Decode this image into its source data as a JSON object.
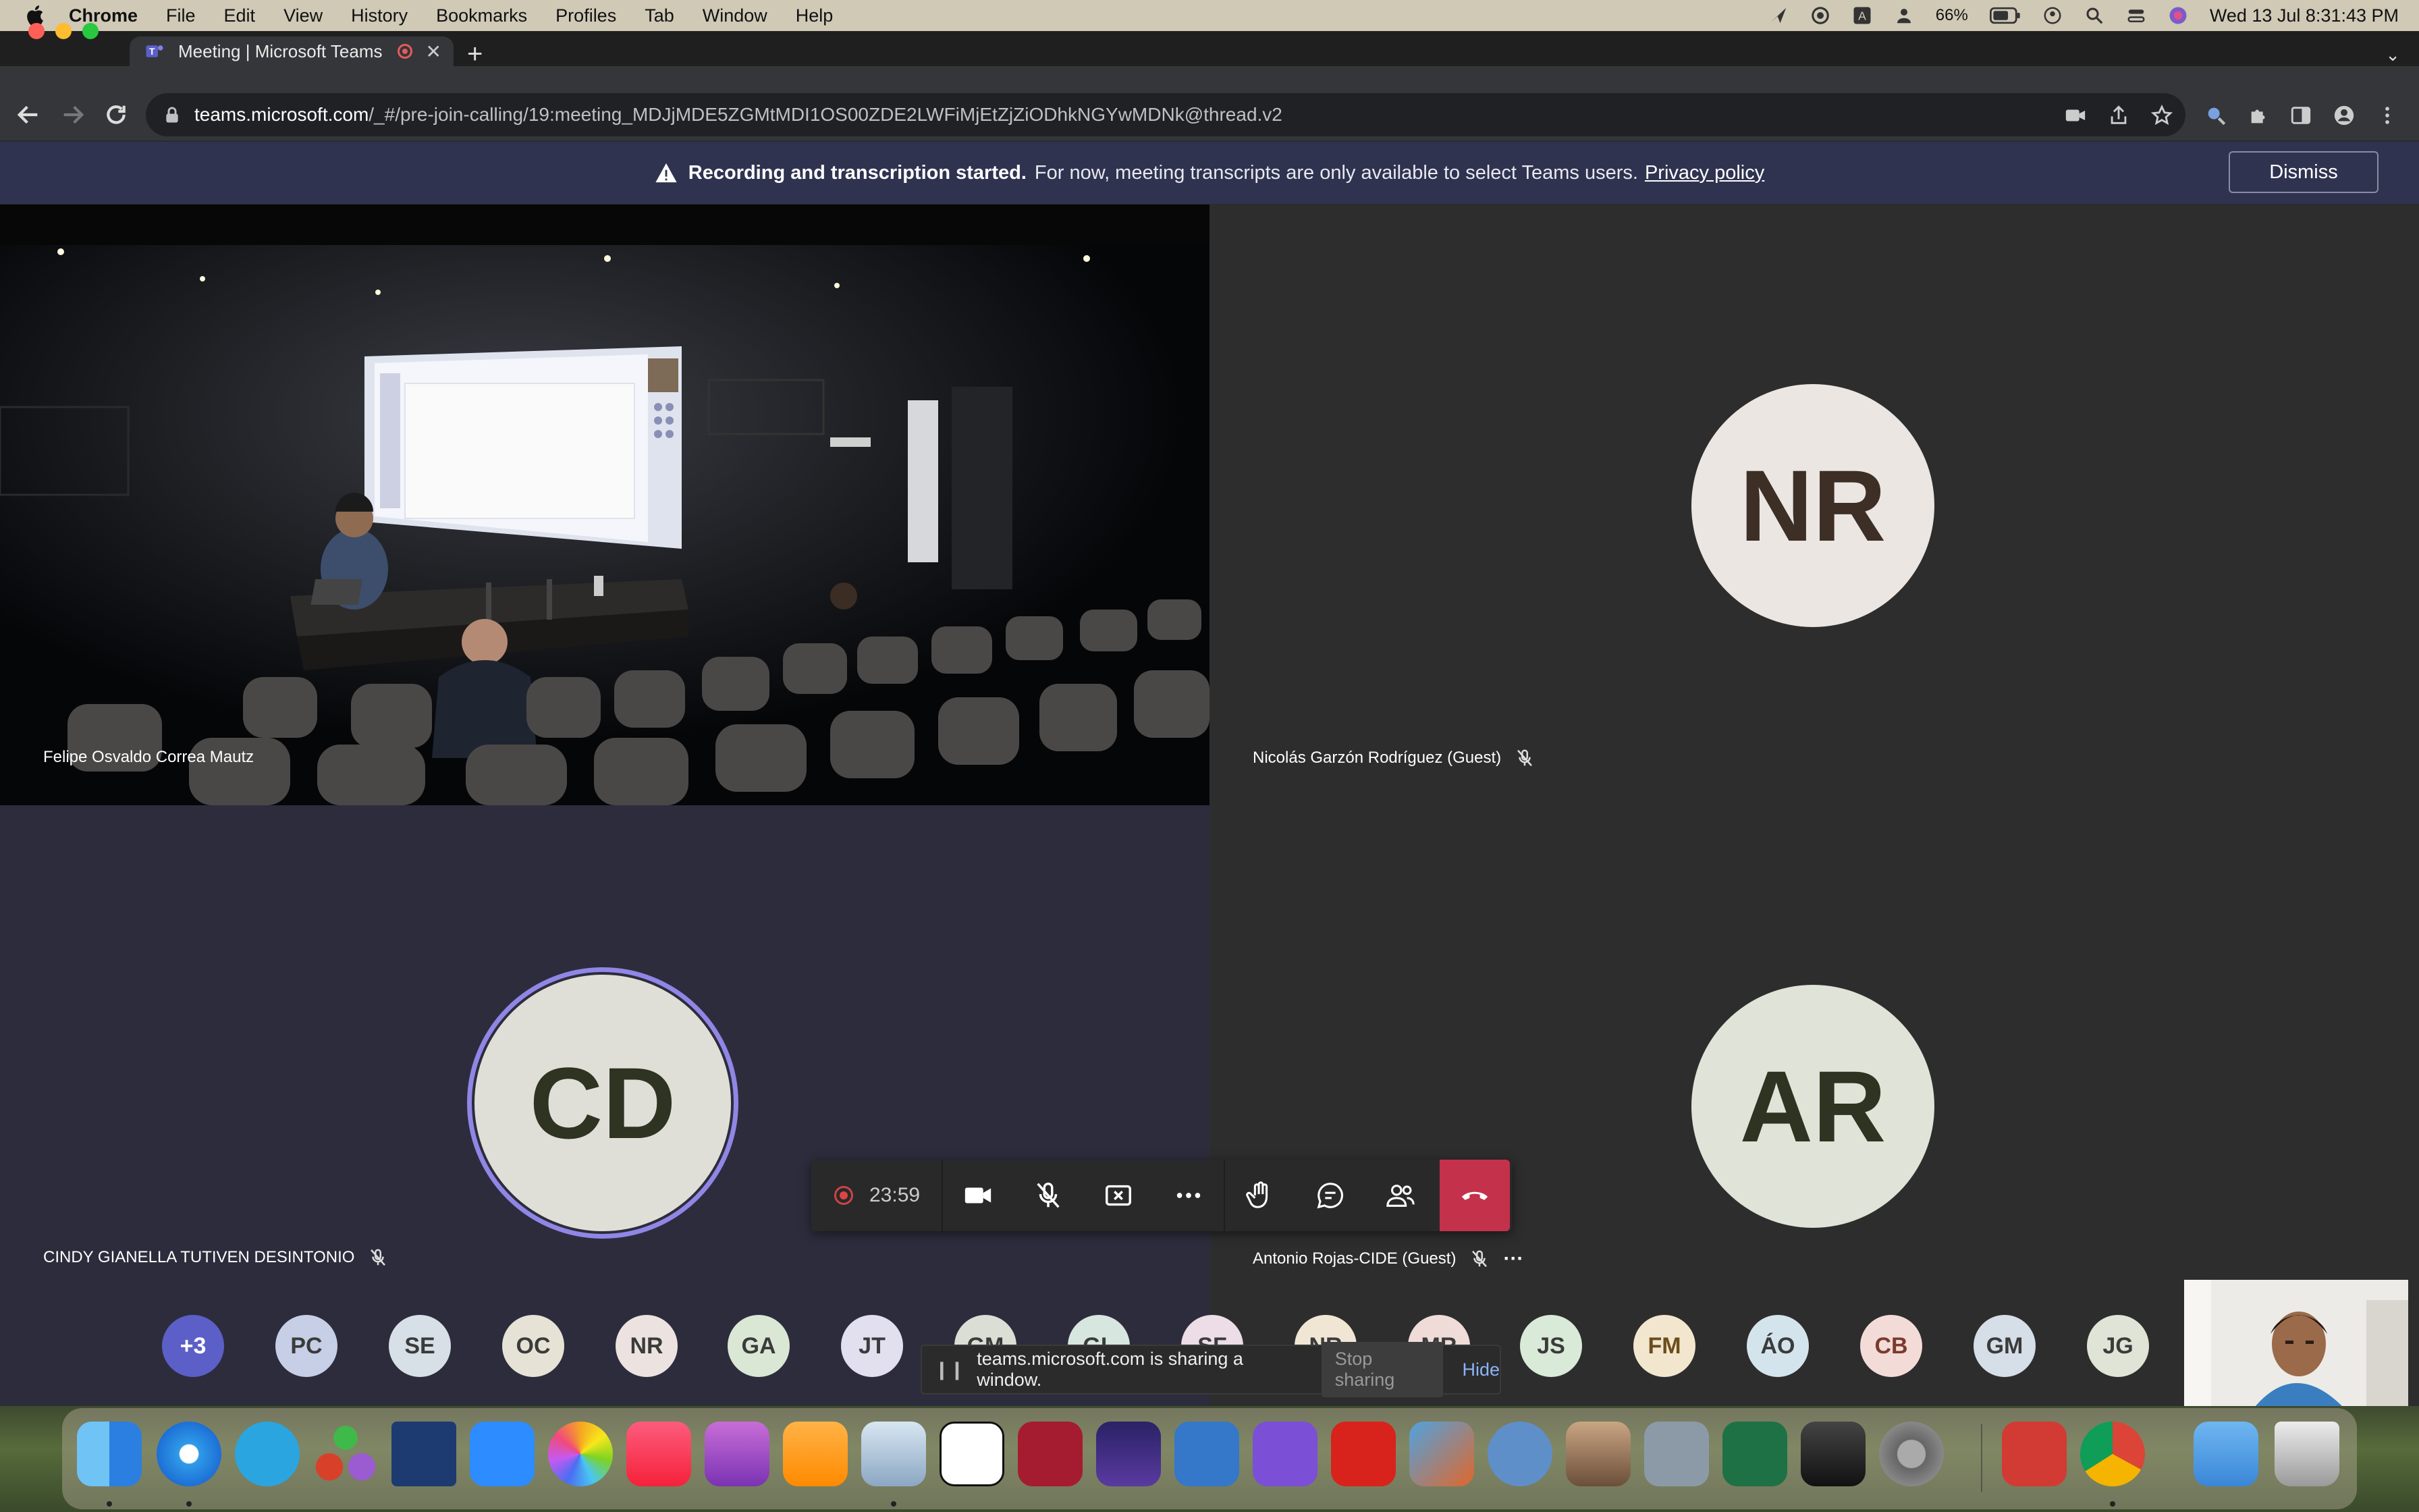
{
  "menubar": {
    "items": [
      "Chrome",
      "File",
      "Edit",
      "View",
      "History",
      "Bookmarks",
      "Profiles",
      "Tab",
      "Window",
      "Help"
    ],
    "battery": "66%",
    "datetime": "Wed 13 Jul  8:31:43 PM"
  },
  "browser": {
    "tab_title": "Meeting | Microsoft Teams",
    "url_host": "teams.microsoft.com",
    "url_path": "/_#/pre-join-calling/19:meeting_MDJjMDE5ZGMtMDI1OS00ZDE2LWFiMjEtZjZiODhkNGYwMDNk@thread.v2"
  },
  "banner": {
    "bold": "Recording and transcription started.",
    "text": "For now, meeting transcripts are only available to select Teams users.",
    "link": "Privacy policy",
    "dismiss": "Dismiss"
  },
  "tiles": {
    "felipe": {
      "name": "Felipe Osvaldo Correa Mautz"
    },
    "nr": {
      "initials": "NR",
      "name": "Nicolás Garzón Rodríguez (Guest)"
    },
    "cd": {
      "initials": "CD",
      "name": "CINDY GIANELLA TUTIVEN DESINTONIO"
    },
    "ar": {
      "initials": "AR",
      "name": "Antonio Rojas-CIDE (Guest)",
      "more": "···"
    }
  },
  "controls": {
    "timer": "23:59"
  },
  "participants": [
    "+3",
    "PC",
    "SE",
    "OC",
    "NR",
    "GA",
    "JT",
    "GM",
    "GL",
    "SF",
    "NR",
    "MR",
    "JS",
    "FM",
    "ÁO",
    "CB",
    "GM",
    "JG"
  ],
  "sharing": {
    "text": "teams.microsoft.com is sharing a window.",
    "stop": "Stop sharing",
    "hide": "Hide"
  },
  "colors": {
    "banner": "#2f3350",
    "hangup": "#c4314b",
    "speaking_ring": "#8f86e6",
    "avatar_fill": "#e0dfd7"
  }
}
